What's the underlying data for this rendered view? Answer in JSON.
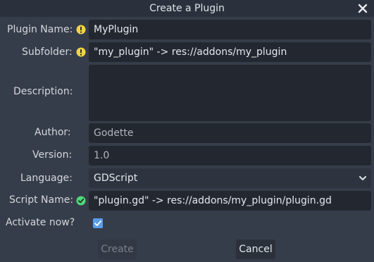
{
  "dialog": {
    "title": "Create a Plugin"
  },
  "form": {
    "plugin_name_label": "Plugin Name:",
    "plugin_name_value": "MyPlugin",
    "subfolder_label": "Subfolder:",
    "subfolder_value": "\"my_plugin\" -> res://addons/my_plugin",
    "description_label": "Description:",
    "description_value": "",
    "author_label": "Author:",
    "author_value": "Godette",
    "version_label": "Version:",
    "version_value": "1.0",
    "language_label": "Language:",
    "language_value": "GDScript",
    "script_name_label": "Script Name:",
    "script_name_value": "\"plugin.gd\" -> res://addons/my_plugin/plugin.gd",
    "activate_label": "Activate now?",
    "activate_checked": true
  },
  "buttons": {
    "create_label": "Create",
    "cancel_label": "Cancel"
  },
  "colors": {
    "warning": "#f0d24c",
    "success": "#4fd87a",
    "accent": "#5a9de8"
  },
  "icons": {
    "close": "close-icon",
    "warning": "warning-icon",
    "success": "check-circle-icon",
    "dropdown": "chevron-down-icon",
    "checkbox": "checkmark-icon"
  }
}
